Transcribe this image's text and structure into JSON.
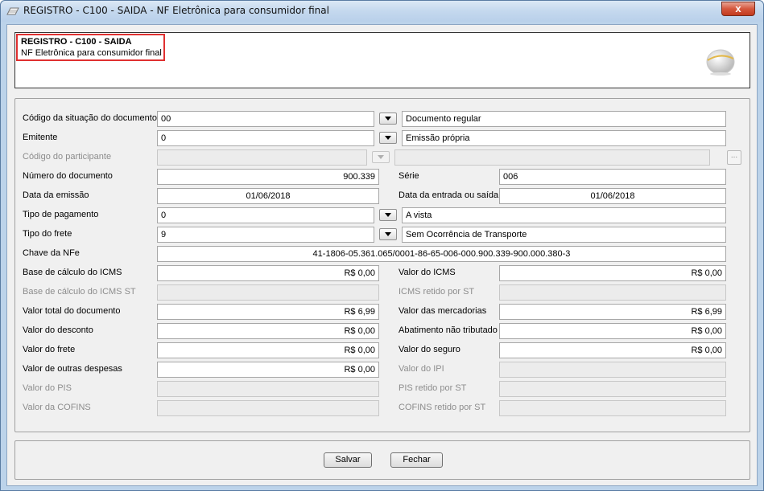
{
  "window": {
    "title": "REGISTRO - C100 - SAIDA - NF Eletrônica para consumidor final",
    "close_label": "x"
  },
  "header": {
    "title": "REGISTRO - C100 - SAIDA",
    "subtitle": "NF Eletrônica para consumidor final"
  },
  "form": {
    "cod_situacao": {
      "label": "Código da situação do documento",
      "value": "00",
      "desc": "Documento regular"
    },
    "emitente": {
      "label": "Emitente",
      "value": "0",
      "desc": "Emissão própria"
    },
    "cod_participante": {
      "label": "Código do participante",
      "value": "",
      "desc": "",
      "lookup": "..."
    },
    "numero_doc": {
      "label": "Número do documento",
      "value": "900.339"
    },
    "serie": {
      "label": "Série",
      "value": "006"
    },
    "data_emissao": {
      "label": "Data da emissão",
      "value": "01/06/2018"
    },
    "data_entrada_saida": {
      "label": "Data da entrada ou saída",
      "value": "01/06/2018"
    },
    "tipo_pagamento": {
      "label": "Tipo de pagamento",
      "value": "0",
      "desc": "A vista"
    },
    "tipo_frete": {
      "label": "Tipo do frete",
      "value": "9",
      "desc": "Sem Ocorrência de Transporte"
    },
    "chave_nfe": {
      "label": "Chave da NFe",
      "value": "41-1806-05.361.065/0001-86-65-006-000.900.339-900.000.380-3"
    },
    "base_icms": {
      "label": "Base de cálculo do ICMS",
      "value": "R$ 0,00"
    },
    "valor_icms": {
      "label": "Valor do ICMS",
      "value": "R$ 0,00"
    },
    "base_icms_st": {
      "label": "Base de cálculo do ICMS ST",
      "value": ""
    },
    "icms_retido_st": {
      "label": "ICMS retido por ST",
      "value": ""
    },
    "valor_total_doc": {
      "label": "Valor total do documento",
      "value": "R$ 6,99"
    },
    "valor_mercadorias": {
      "label": "Valor das mercadorias",
      "value": "R$ 6,99"
    },
    "valor_desconto": {
      "label": "Valor do desconto",
      "value": "R$ 0,00"
    },
    "abatimento": {
      "label": "Abatimento não tributado",
      "value": "R$ 0,00"
    },
    "valor_frete": {
      "label": "Valor do frete",
      "value": "R$ 0,00"
    },
    "valor_seguro": {
      "label": "Valor do seguro",
      "value": "R$ 0,00"
    },
    "outras_despesas": {
      "label": "Valor de outras despesas",
      "value": "R$ 0,00"
    },
    "valor_ipi": {
      "label": "Valor do IPI",
      "value": ""
    },
    "valor_pis": {
      "label": "Valor do PIS",
      "value": ""
    },
    "pis_retido_st": {
      "label": "PIS retido por ST",
      "value": ""
    },
    "valor_cofins": {
      "label": "Valor da COFINS",
      "value": ""
    },
    "cofins_retido_st": {
      "label": "COFINS retido por ST",
      "value": ""
    }
  },
  "footer": {
    "save_label": "Salvar",
    "close_label": "Fechar"
  }
}
